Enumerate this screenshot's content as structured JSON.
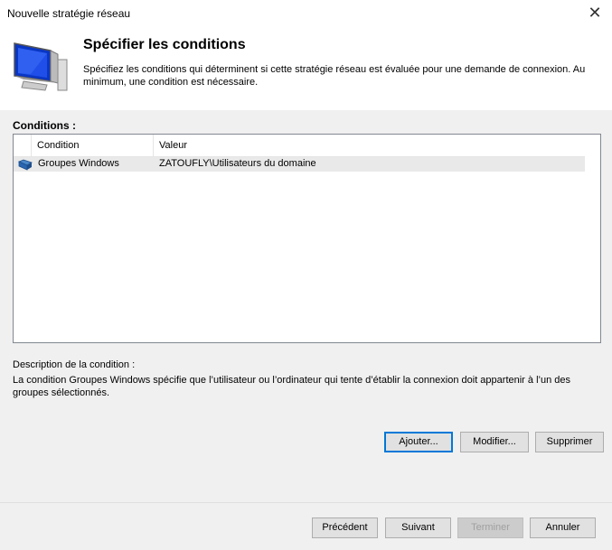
{
  "window": {
    "title": "Nouvelle stratégie réseau",
    "close_glyph": "✕"
  },
  "header": {
    "title": "Spécifier les conditions",
    "description": "Spécifiez les conditions qui déterminent si cette stratégie réseau est évaluée pour une demande de connexion. Au minimum, une condition est nécessaire.",
    "icon": "monitor-icon"
  },
  "conditions": {
    "label": "Conditions :",
    "columns": [
      "Condition",
      "Valeur"
    ],
    "rows": [
      {
        "icon": "windows-groups-icon",
        "condition": "Groupes Windows",
        "value": "ZATOUFLY\\Utilisateurs du domaine"
      }
    ]
  },
  "description": {
    "label": "Description de la condition :",
    "text": "La condition Groupes Windows spécifie que l’utilisateur ou l’ordinateur qui tente d’établir la connexion doit appartenir à l’un des groupes sélectionnés."
  },
  "actions": {
    "add": "Ajouter...",
    "edit": "Modifier...",
    "remove": "Supprimer"
  },
  "footer": {
    "previous": "Précédent",
    "next": "Suivant",
    "finish": "Terminer",
    "cancel": "Annuler"
  },
  "colors": {
    "focus_border": "#0078d7",
    "button_bg": "#e1e1e1",
    "dialog_bg": "#f0f0f0"
  }
}
